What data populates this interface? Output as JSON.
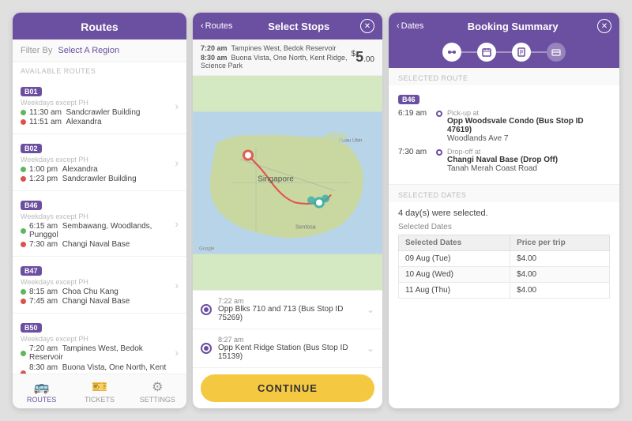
{
  "panels": {
    "routes": {
      "title": "Routes",
      "filter_label": "Filter By",
      "filter_value": "Select A Region",
      "available_label": "AVAILABLE ROUTES",
      "items": [
        {
          "badge": "B01",
          "days": "Weekdays except PH",
          "times": [
            "11:30 am",
            "11:51 am"
          ],
          "stops": [
            "Sandcrawler Building",
            "Alexandra"
          ]
        },
        {
          "badge": "B02",
          "days": "Weekdays except PH",
          "times": [
            "1:00 pm",
            "1:23 pm"
          ],
          "stops": [
            "Alexandra",
            "Sandcrawler Building"
          ]
        },
        {
          "badge": "B46",
          "days": "Weekdays except PH",
          "times": [
            "6:15 am",
            "7:30 am"
          ],
          "stops": [
            "Sembawang, Woodlands, Punggol",
            "Changi Naval Base"
          ]
        },
        {
          "badge": "B47",
          "days": "Weekdays except PH",
          "times": [
            "8:15 am",
            "7:45 am"
          ],
          "stops": [
            "Choa Chu Kang",
            "Changi Naval Base"
          ]
        },
        {
          "badge": "B50",
          "days": "Weekdays except PH",
          "times": [
            "7:20 am",
            "8:30 am"
          ],
          "stops": [
            "Tampines West, Bedok Reservoir",
            "Buona Vista, One North, Kent Ridge, Science Park"
          ]
        }
      ],
      "nav": [
        "ROUTES",
        "TICKETS",
        "SETTINGS"
      ],
      "nav_icons": [
        "🚌",
        "🎫",
        "⚙"
      ]
    },
    "select_stops": {
      "back_label": "< Routes",
      "title": "Select Stops",
      "summary_time1": "7:20 am  Tampines West, Bedok Reservoir",
      "summary_time2": "8:30 am  Buona Vista, One North, Kent Ridge, Science Park",
      "price": "5",
      "price_prefix": "$",
      "price_suffix": ".00",
      "stops": [
        {
          "time": "7:22 am",
          "name": "Opp Blks 710 and 713 (Bus Stop ID 75269)"
        },
        {
          "time": "8:27 am",
          "name": "Opp Kent Ridge Station (Bus Stop ID 15139)"
        }
      ],
      "continue_label": "CONTINUE"
    },
    "booking": {
      "back_label": "< Dates",
      "title": "Booking Summary",
      "steps": [
        "route",
        "date",
        "summary",
        "payment"
      ],
      "selected_route_label": "SELECTED ROUTE",
      "route_badge": "B46",
      "pickup_time": "6:19 am",
      "pickup_label": "Pick-up at",
      "pickup_name": "Opp Woodsvale Condo (Bus Stop ID 47619)",
      "pickup_road": "Woodlands Ave 7",
      "dropoff_time": "7:30 am",
      "dropoff_label": "Drop-off at",
      "dropoff_name": "Changi Naval Base (Drop Off)",
      "dropoff_road": "Tanah Merah Coast Road",
      "selected_dates_label": "SELECTED DATES",
      "dates_count": "4 day(s) were selected.",
      "dates_sub": "Selected Dates",
      "table_headers": [
        "Selected Dates",
        "Price per trip"
      ],
      "dates_rows": [
        [
          "09 Aug (Tue)",
          "$4.00"
        ],
        [
          "10 Aug (Wed)",
          "$4.00"
        ],
        [
          "11 Aug (Thu)",
          "$4.00"
        ]
      ]
    }
  }
}
